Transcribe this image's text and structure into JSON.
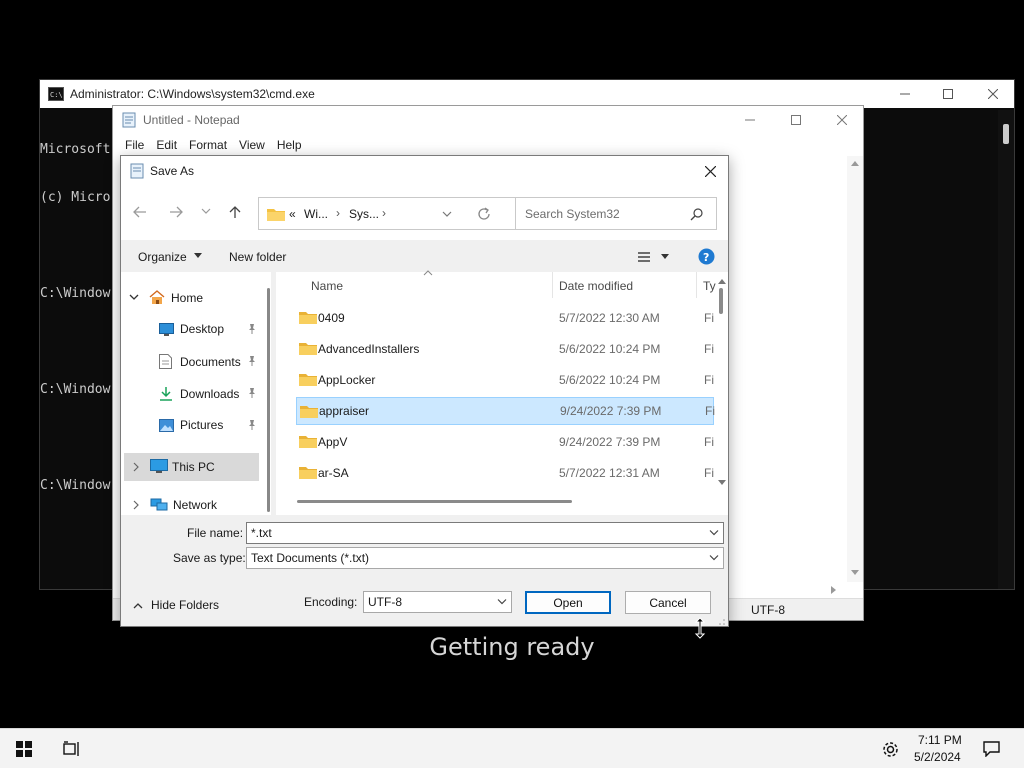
{
  "cmd": {
    "title": "Administrator: C:\\Windows\\system32\\cmd.exe",
    "lines": [
      "Microsoft",
      "(c) Micro",
      "",
      "C:\\Window",
      "",
      "C:\\Window",
      "",
      "C:\\Window"
    ]
  },
  "notepad": {
    "title": "Untitled - Notepad",
    "menu": [
      "File",
      "Edit",
      "Format",
      "View",
      "Help"
    ],
    "status_encoding": "UTF-8"
  },
  "dialog": {
    "title": "Save As",
    "breadcrumb": {
      "prefix": "«",
      "part1": "Wi...",
      "part2": "Sys..."
    },
    "search_placeholder": "Search System32",
    "toolbar": {
      "organize": "Organize",
      "new_folder": "New folder"
    },
    "sidebar": {
      "home": "Home",
      "desktop": "Desktop",
      "documents": "Documents",
      "downloads": "Downloads",
      "pictures": "Pictures",
      "this_pc": "This PC",
      "network": "Network"
    },
    "columns": {
      "name": "Name",
      "date": "Date modified",
      "type": "Ty"
    },
    "files": [
      {
        "name": "0409",
        "date": "5/7/2022 12:30 AM",
        "type": "Fi"
      },
      {
        "name": "AdvancedInstallers",
        "date": "5/6/2022 10:24 PM",
        "type": "Fi"
      },
      {
        "name": "AppLocker",
        "date": "5/6/2022 10:24 PM",
        "type": "Fi"
      },
      {
        "name": "appraiser",
        "date": "9/24/2022 7:39 PM",
        "type": "Fi"
      },
      {
        "name": "AppV",
        "date": "9/24/2022 7:39 PM",
        "type": "Fi"
      },
      {
        "name": "ar-SA",
        "date": "5/7/2022 12:31 AM",
        "type": "Fi"
      }
    ],
    "file_name_label": "File name:",
    "file_name_value": "*.txt",
    "save_type_label": "Save as type:",
    "save_type_value": "Text Documents (*.txt)",
    "hide_folders": "Hide Folders",
    "encoding_label": "Encoding:",
    "encoding_value": "UTF-8",
    "open_label": "Open",
    "cancel_label": "Cancel"
  },
  "overlay_text": "Getting ready",
  "taskbar": {
    "time": "7:11 PM",
    "date": "5/2/2024"
  },
  "colors": {
    "accent": "#0067c0",
    "selection": "#cce8ff",
    "folder": "#f4c242"
  }
}
